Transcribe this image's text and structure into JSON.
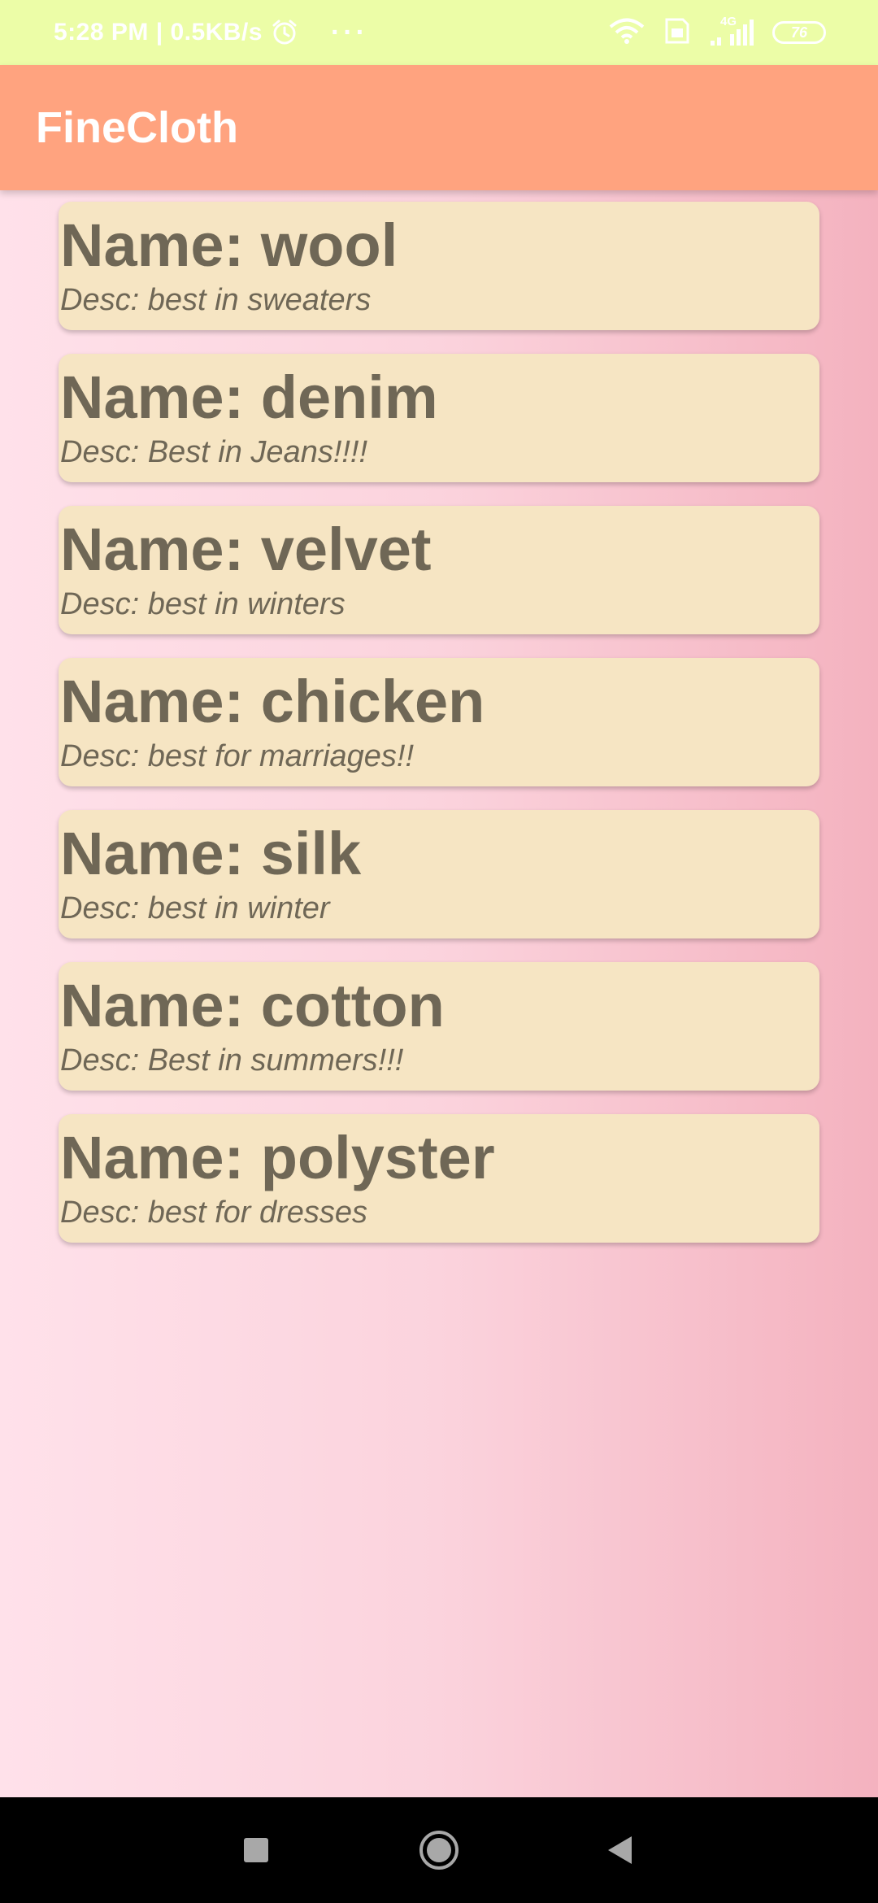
{
  "status_bar": {
    "time_speed": "5:28 PM | 0.5KB/s",
    "more": "···",
    "network": "4G",
    "battery": "76",
    "icons": [
      "alarm-icon",
      "wifi-icon",
      "sim-icon",
      "signal-icon",
      "battery-icon"
    ]
  },
  "app_bar": {
    "title": "FineCloth",
    "color": "#ffa37f"
  },
  "items": [
    {
      "name": "Name: wool",
      "desc": "Desc: best in sweaters"
    },
    {
      "name": "Name: denim",
      "desc": "Desc: Best in Jeans!!!!"
    },
    {
      "name": "Name: velvet",
      "desc": "Desc: best in winters"
    },
    {
      "name": "Name: chicken",
      "desc": "Desc: best for marriages!!"
    },
    {
      "name": "Name: silk",
      "desc": "Desc: best in winter"
    },
    {
      "name": "Name: cotton",
      "desc": "Desc: Best in summers!!!"
    },
    {
      "name": "Name: polyster",
      "desc": "Desc: best for dresses"
    }
  ],
  "nav_bar": {
    "icons": [
      "recents-icon",
      "home-icon",
      "back-icon"
    ]
  },
  "colors": {
    "status_bar": "#ecfda7",
    "card": "#f6e5c3",
    "text": "#6f6756"
  }
}
